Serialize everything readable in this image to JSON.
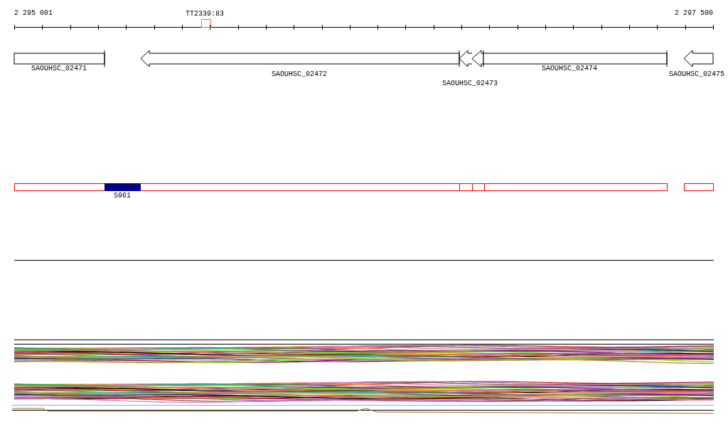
{
  "ruler": {
    "start_label": "2 295 001",
    "end_label": "2 297 500",
    "marker_label": "TT2339:83"
  },
  "genes": [
    {
      "label": "SAOUHSC_02471",
      "kind": "block"
    },
    {
      "label": "SAOUHSC_02472",
      "kind": "arrow"
    },
    {
      "label": "SAOUHSC_02473",
      "kind": "double_arrow"
    },
    {
      "label": "SAOUHSC_02474",
      "kind": "block"
    },
    {
      "label": "SAOUHSC_02475",
      "kind": "arrow"
    }
  ],
  "feature_track": {
    "highlight_label": "S961"
  }
}
